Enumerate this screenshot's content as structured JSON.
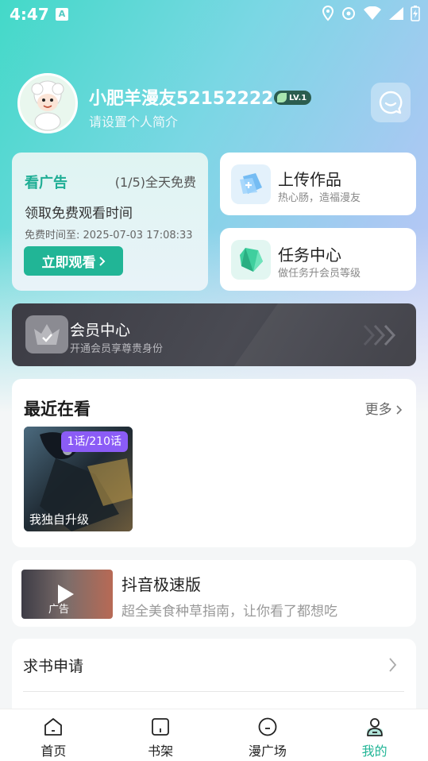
{
  "status_bar": {
    "time": "4:47",
    "notification_icon": "A"
  },
  "profile": {
    "username": "小肥羊漫友52152222",
    "level": "LV.1",
    "bio": "请设置个人简介",
    "avatar_caption": "小肥羊"
  },
  "ad_card": {
    "title": "看广告",
    "count": "(1/5)全天免费",
    "description": "领取免费观看时间",
    "free_until": "免费时间至:  2025-07-03 17:08:33",
    "button_label": "立即观看"
  },
  "upload": {
    "title": "上传作品",
    "subtitle": "热心肠，造福漫友"
  },
  "task": {
    "title": "任务中心",
    "subtitle": "做任务升会员等级"
  },
  "vip": {
    "title": "会员中心",
    "subtitle": "开通会员享尊贵身份"
  },
  "recent": {
    "title": "最近在看",
    "more_label": "更多",
    "items": [
      {
        "name": "我独自升级",
        "progress": "1话/210话"
      }
    ]
  },
  "sponsor": {
    "title": "抖音极速版",
    "subtitle": "超全美食种草指南，让你看了都想吃",
    "ad_tag": "广告"
  },
  "list": {
    "items": [
      {
        "label": "求书申请"
      }
    ]
  },
  "tabbar": {
    "tabs": [
      {
        "label": "首页",
        "icon": "home-icon"
      },
      {
        "label": "书架",
        "icon": "bookshelf-icon"
      },
      {
        "label": "漫广场",
        "icon": "square-icon"
      },
      {
        "label": "我的",
        "icon": "profile-icon",
        "active": true
      }
    ]
  },
  "colors": {
    "accent": "#21b596",
    "vip_bg": "#3c3c44",
    "badge_purple": "#8b5cf6"
  }
}
